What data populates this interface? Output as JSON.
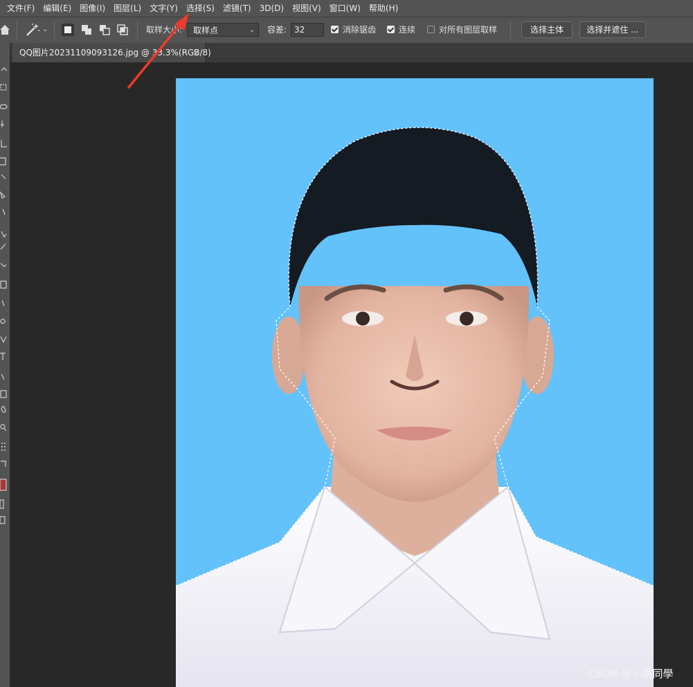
{
  "menubar": {
    "items": [
      "文件(F)",
      "编辑(E)",
      "图像(I)",
      "图层(L)",
      "文字(Y)",
      "选择(S)",
      "滤镜(T)",
      "3D(D)",
      "视图(V)",
      "窗口(W)",
      "帮助(H)"
    ]
  },
  "options_bar": {
    "tool_icon": "magic-wand-icon",
    "sample_size_label": "取样大小:",
    "sample_size_value": "取样点",
    "tolerance_label": "容差:",
    "tolerance_value": "32",
    "anti_alias": {
      "label": "消除锯齿",
      "checked": true
    },
    "contiguous": {
      "label": "连续",
      "checked": true
    },
    "sample_all_layers": {
      "label": "对所有图层取样",
      "checked": false
    },
    "select_subject_label": "选择主体",
    "select_and_mask_label": "选择并遮住 ..."
  },
  "document_tab": {
    "title": "QQ图片20231109093126.jpg @ 33.3%(RGB/8)",
    "close": "×"
  },
  "toolbar": {
    "tools": [
      "move-icon",
      "marquee-icon",
      "lasso-icon",
      "quick-select-icon",
      "crop-icon",
      "frame-icon",
      "eyedropper-icon",
      "healing-brush-icon",
      "brush-icon",
      "clone-stamp-icon",
      "history-brush-icon",
      "eraser-icon",
      "gradient-icon",
      "blur-icon",
      "dodge-icon",
      "pen-icon",
      "type-icon",
      "path-select-icon",
      "rectangle-icon",
      "hand-icon",
      "zoom-icon",
      "more-tools-icon",
      "swap-colors-icon"
    ],
    "foreground_color": "#a33a3d",
    "background_color": "#ffffff"
  },
  "canvas": {
    "background_color": "#64c2fb",
    "image_description": "证件照"
  },
  "annotation": {
    "arrow_color": "#ee3a2c"
  },
  "watermark": "CSDN @小鹏同學"
}
